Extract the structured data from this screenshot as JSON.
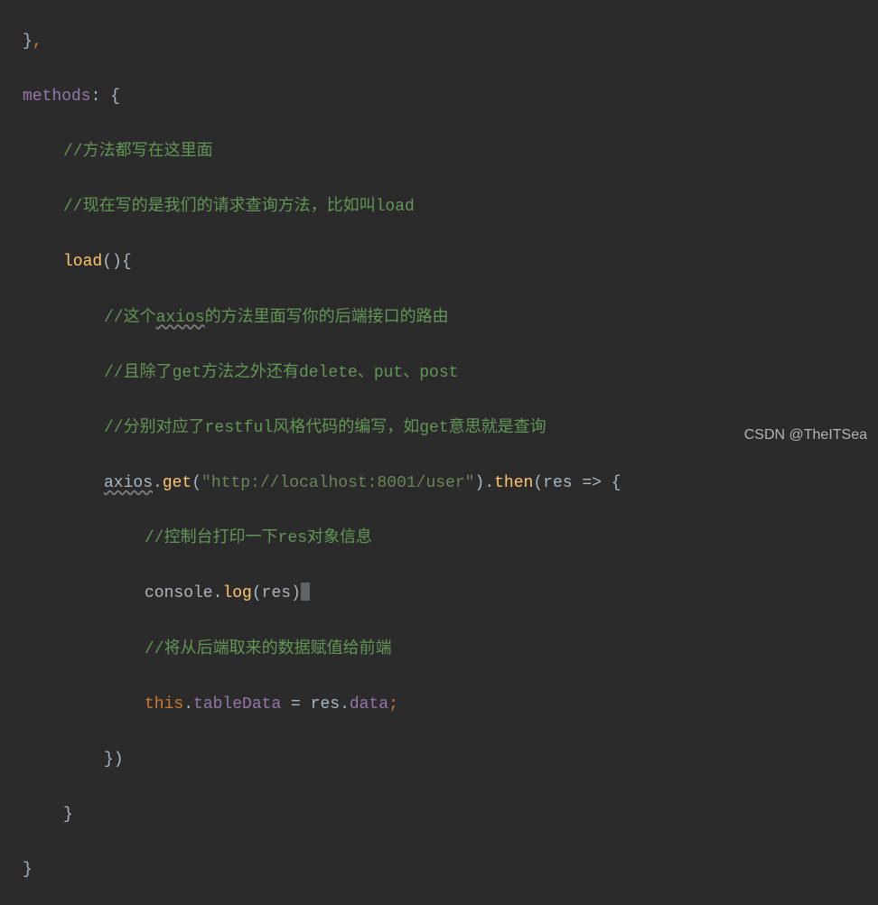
{
  "code": {
    "line1_brace": "}",
    "line1_comma": ",",
    "line2_methods": "methods",
    "line2_colon": ": ",
    "line2_brace": "{",
    "line3_comment": "//方法都写在这里面",
    "line4_comment": "//现在写的是我们的请求查询方法，比如叫load",
    "line5_load": "load",
    "line5_parens": "()",
    "line5_brace": "{",
    "line6_comment_pre": "//这个",
    "line6_axios": "axios",
    "line6_comment_post": "的方法里面写你的后端接口的路由",
    "line7_comment": "//且除了get方法之外还有delete、put、post",
    "line8_comment": "//分别对应了restful风格代码的编写，如get意思就是查询",
    "line9_axios": "axios",
    "line9_dot1": ".",
    "line9_get": "get",
    "line9_paren_open": "(",
    "line9_string": "\"http://localhost:8001/user\"",
    "line9_paren_close": ")",
    "line9_dot2": ".",
    "line9_then": "then",
    "line9_paren_open2": "(",
    "line9_res": "res",
    "line9_arrow": " => ",
    "line9_brace": "{",
    "line10_comment": "//控制台打印一下res对象信息",
    "line11_console": "console",
    "line11_dot": ".",
    "line11_log": "log",
    "line11_paren_open": "(",
    "line11_res": "res",
    "line11_paren_close": ")",
    "line12_comment": "//将从后端取来的数据赋值给前端",
    "line13_this": "this",
    "line13_dot1": ".",
    "line13_tableData": "tableData",
    "line13_eq": " = ",
    "line13_res": "res",
    "line13_dot2": ".",
    "line13_data": "data",
    "line13_semi": ";",
    "line14_close": "})",
    "line15_close": "}",
    "line16_close": "}"
  },
  "watermark": "CSDN @TheITSea"
}
